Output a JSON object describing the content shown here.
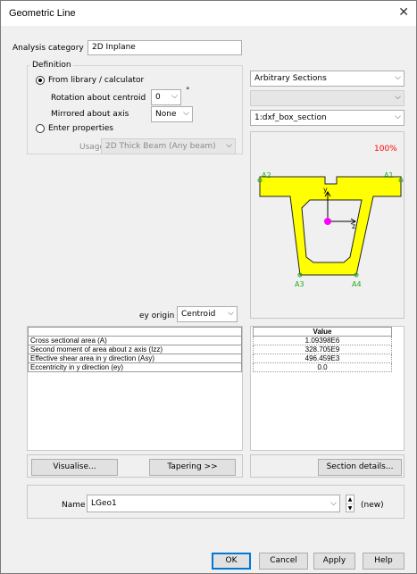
{
  "window": {
    "title": "Geometric Line"
  },
  "analysis": {
    "label": "Analysis category",
    "value": "2D Inplane"
  },
  "definition": {
    "group_label": "Definition",
    "from_library_label": "From library / calculator",
    "rotation_label": "Rotation about centroid",
    "rotation_value": "0",
    "degree_symbol": "°",
    "mirrored_label": "Mirrored about axis",
    "mirrored_value": "None",
    "enter_props_label": "Enter properties",
    "usage_label": "Usage",
    "usage_value": "2D Thick Beam (Any beam)"
  },
  "section": {
    "type_value": "Arbitrary Sections",
    "subtype_value": "",
    "name_value": "1:dxf_box_section",
    "zoom": "100%",
    "labels": {
      "a1": "A1",
      "a2": "A2",
      "a3": "A3",
      "a4": "A4",
      "y": "y",
      "z": "z"
    }
  },
  "ey_origin": {
    "label": "ey origin",
    "value": "Centroid"
  },
  "properties": {
    "value_header": "Value",
    "rows": [
      {
        "name": "Cross sectional area (A)",
        "value": "1.09398E6"
      },
      {
        "name": "Second moment of area about z axis (Izz)",
        "value": "328.705E9"
      },
      {
        "name": "Effective shear area in y direction (Asy)",
        "value": "496.459E3"
      },
      {
        "name": "Eccentricity in y direction (ey)",
        "value": "0.0"
      }
    ]
  },
  "buttons": {
    "visualise": "Visualise...",
    "tapering": "Tapering >>",
    "section_details": "Section details...",
    "ok": "OK",
    "cancel": "Cancel",
    "apply": "Apply",
    "help": "Help"
  },
  "name_field": {
    "label": "Name",
    "value": "LGeo1",
    "status": "(new)"
  },
  "colors": {
    "section_fill": "#ffff00",
    "node": "#22aa22",
    "centroid": "#ff00ff",
    "zoom": "#ff0000"
  }
}
